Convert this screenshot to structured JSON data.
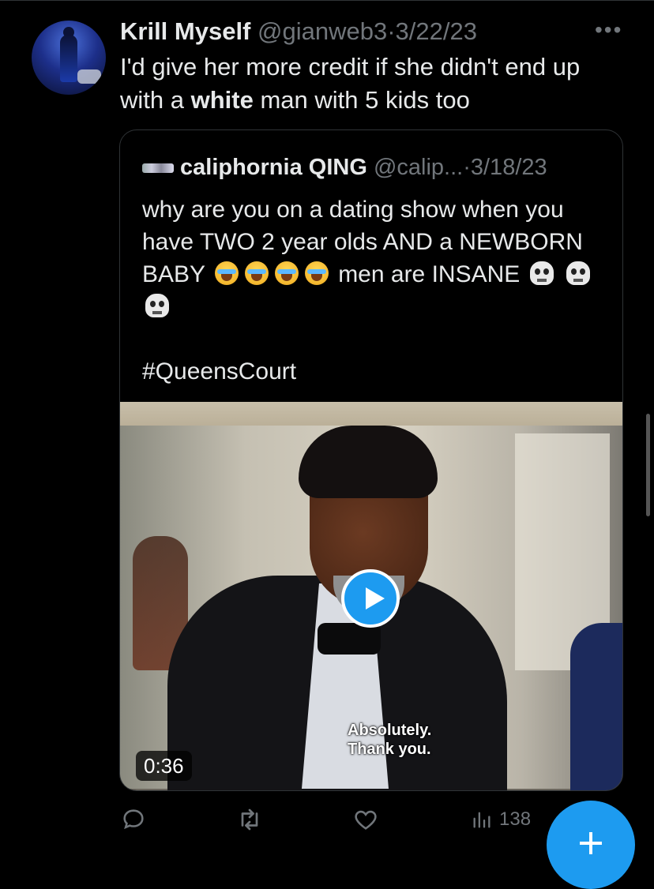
{
  "tweet": {
    "author_name": "Krill Myself",
    "handle": "@gianweb3",
    "separator": "·",
    "date": "3/22/23",
    "text_before": "I'd give her more credit if she didn't end up with a ",
    "text_bold": "white",
    "text_after": " man with 5 kids too"
  },
  "quote": {
    "author_name": "caliphornia QING",
    "handle": "@calip...",
    "separator": "·",
    "date": "3/18/23",
    "text_line": "why are you on a dating show when you have TWO 2 year olds AND a NEWBORN BABY",
    "text_after_emojis": "men are INSANE",
    "hashtag": "#QueensCourt",
    "video": {
      "subtitle_line1": "Absolutely.",
      "subtitle_line2": "Thank you.",
      "duration": "0:36"
    }
  },
  "actions": {
    "views": "138"
  },
  "colors": {
    "accent": "#1d9bf0",
    "background": "#000000",
    "muted": "#71767b"
  },
  "icons": [
    "more-icon",
    "reply-icon",
    "retweet-icon",
    "like-icon",
    "views-icon",
    "play-icon",
    "compose-icon"
  ]
}
